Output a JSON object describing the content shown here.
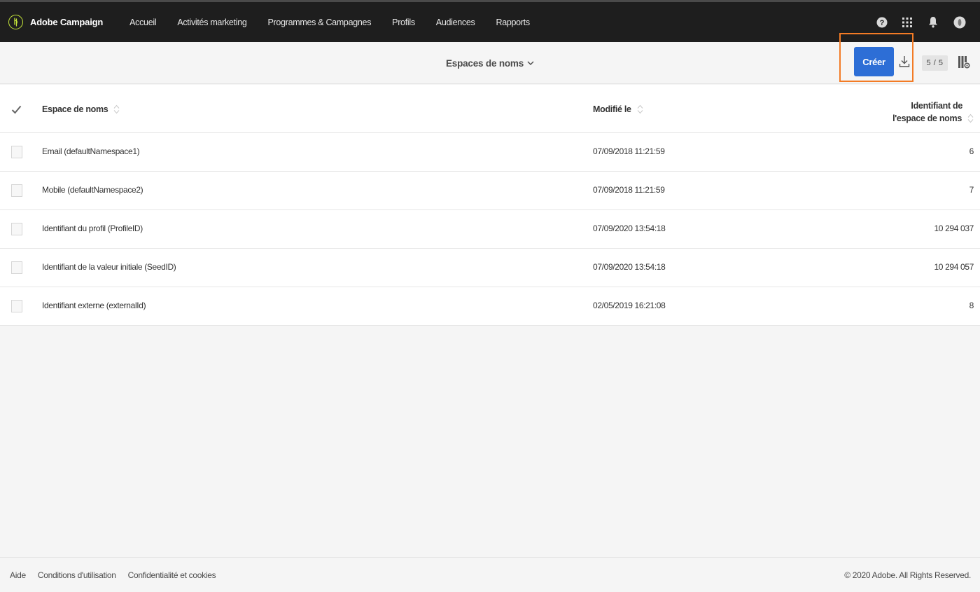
{
  "app": {
    "brand": "Adobe Campaign",
    "brand_color": "#c5e63a"
  },
  "nav": {
    "items": [
      {
        "label": "Accueil"
      },
      {
        "label": "Activités marketing"
      },
      {
        "label": "Programmes & Campagnes"
      },
      {
        "label": "Profils"
      },
      {
        "label": "Audiences"
      },
      {
        "label": "Rapports"
      }
    ],
    "right_icons": [
      "help-icon",
      "apps-grid-icon",
      "notifications-bell-icon",
      "user-avatar-icon"
    ]
  },
  "toolbar": {
    "view_title": "Espaces de noms",
    "create_label": "Créer",
    "create_color": "#2d6ed6",
    "highlight_color": "#f37b25",
    "record_count": "5 / 5"
  },
  "table": {
    "columns": {
      "name": "Espace de noms",
      "modified": "Modifié le",
      "identifier_line1": "Identifiant de",
      "identifier_line2": "l'espace de noms"
    },
    "rows": [
      {
        "name": "Email (defaultNamespace1)",
        "modified": "07/09/2018 11:21:59",
        "id": "6"
      },
      {
        "name": "Mobile (defaultNamespace2)",
        "modified": "07/09/2018 11:21:59",
        "id": "7"
      },
      {
        "name": "Identifiant du profil (ProfileID)",
        "modified": "07/09/2020 13:54:18",
        "id": "10 294 037"
      },
      {
        "name": "Identifiant de la valeur initiale (SeedID)",
        "modified": "07/09/2020 13:54:18",
        "id": "10 294 057"
      },
      {
        "name": "Identifiant externe (externalId)",
        "modified": "02/05/2019 16:21:08",
        "id": "8"
      }
    ]
  },
  "footer": {
    "links": [
      {
        "label": "Aide"
      },
      {
        "label": "Conditions d'utilisation"
      },
      {
        "label": "Confidentialité et cookies"
      }
    ],
    "copyright": "© 2020 Adobe. All Rights Reserved."
  }
}
